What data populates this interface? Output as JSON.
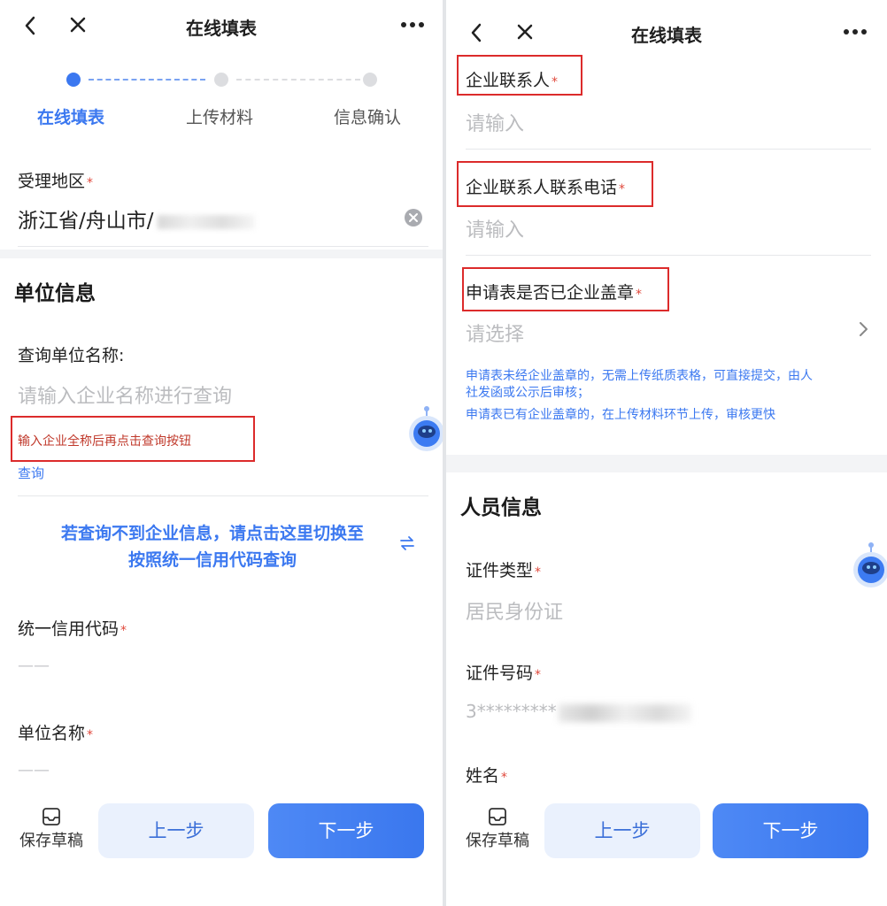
{
  "left": {
    "header": {
      "title": "在线填表"
    },
    "steps": [
      {
        "label": "在线填表",
        "active": true
      },
      {
        "label": "上传材料",
        "active": false
      },
      {
        "label": "信息确认",
        "active": false
      }
    ],
    "region": {
      "label": "受理地区",
      "value": "浙江省/舟山市/"
    },
    "unit_section": {
      "title": "单位信息"
    },
    "query": {
      "label": "查询单位名称:",
      "placeholder": "请输入企业名称进行查询",
      "hint": "输入企业全称后再点击查询按钮",
      "button": "查询"
    },
    "switch_link": {
      "line1": "若查询不到企业信息，请点击这里切换至",
      "line2": "按照统一信用代码查询"
    },
    "credit_code": {
      "label": "统一信用代码",
      "value": "——"
    },
    "unit_name": {
      "label": "单位名称",
      "value": "——"
    },
    "bottom": {
      "draft": "保存草稿",
      "prev": "上一步",
      "next": "下一步"
    }
  },
  "right": {
    "header": {
      "title": "在线填表"
    },
    "contact": {
      "label": "企业联系人",
      "placeholder": "请输入"
    },
    "contact_phone": {
      "label": "企业联系人联系电话",
      "placeholder": "请输入"
    },
    "stamped": {
      "label": "申请表是否已企业盖章",
      "placeholder": "请选择"
    },
    "notes": {
      "line1": "申请表未经企业盖章的，无需上传纸质表格，可直接提交，由人",
      "line2": "社发函或公示后审核；",
      "line3": "申请表已有企业盖章的，在上传材料环节上传，审核更快"
    },
    "person_section": {
      "title": "人员信息"
    },
    "id_type": {
      "label": "证件类型",
      "value": "居民身份证"
    },
    "id_number": {
      "label": "证件号码",
      "value": "3*********"
    },
    "name": {
      "label": "姓名"
    },
    "bottom": {
      "draft": "保存草稿",
      "prev": "上一步",
      "next": "下一步"
    }
  },
  "colors": {
    "accent": "#3b78f0",
    "required": "#e0483b",
    "hint_red": "#c0392b",
    "highlight_box": "#dc2b2b",
    "placeholder": "#bbbcbf"
  },
  "icons": [
    "chevron-left-icon",
    "close-icon",
    "more-icon",
    "clear-icon",
    "chevron-right-icon",
    "swap-icon",
    "draft-icon",
    "assistant-robot-icon"
  ]
}
